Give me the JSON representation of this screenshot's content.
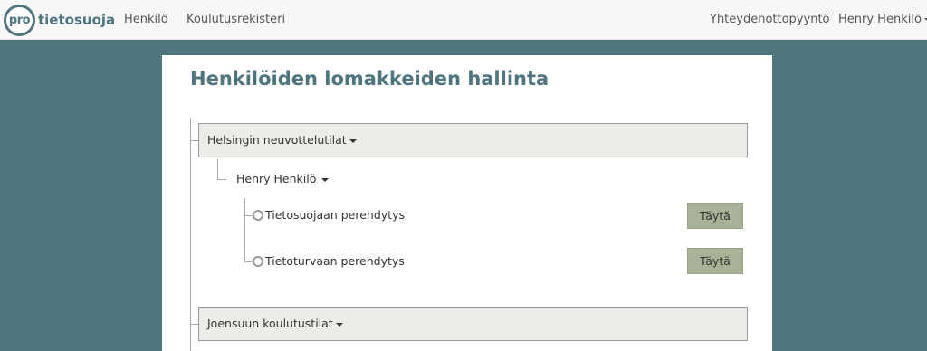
{
  "navbar": {
    "logo": {
      "mark": "pro",
      "name": "tietosuoja"
    },
    "links": [
      "Henkilö",
      "Koulutusrekisteri"
    ],
    "contact": "Yhteydenottopyyntö",
    "user": "Henry Henkilö"
  },
  "page": {
    "title": "Henkilöiden lomakkeiden hallinta"
  },
  "groups": [
    {
      "label": "Helsingin neuvottelutilat",
      "person": "Henry Henkilö",
      "forms": [
        {
          "label": "Tietosuojaan perehdytys",
          "action": "Täytä"
        },
        {
          "label": "Tietoturvaan perehdytys",
          "action": "Täytä"
        }
      ]
    },
    {
      "label": "Joensuun koulutustilat"
    }
  ]
}
